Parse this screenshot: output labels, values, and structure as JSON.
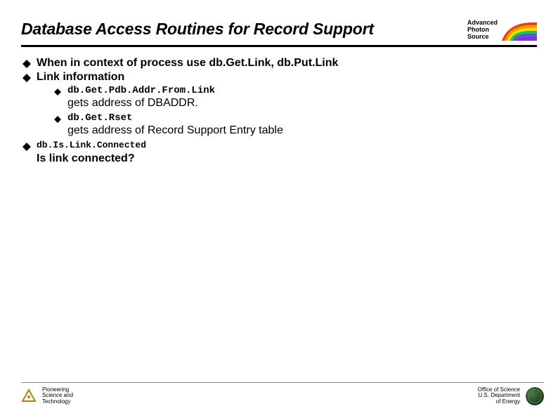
{
  "title": "Database Access Routines for Record Support",
  "logo_aps": {
    "line1": "Advanced",
    "line2": "Photon",
    "line3": "Source"
  },
  "bullets": {
    "b1": "When in context of process use db.Get.Link, db.Put.Link",
    "b2": "Link information",
    "b2a_code": "db.Get.Pdb.Addr.From.Link",
    "b2a_desc": "gets address of DBADDR.",
    "b2b_code": "db.Get.Rset",
    "b2b_desc": "gets address of Record Support Entry table",
    "b3_code": "db.Is.Link.Connected",
    "b3_desc": "Is link connected?"
  },
  "footer": {
    "left1": "Pioneering",
    "left2": "Science and",
    "left3": "Technology",
    "right1": "Office of Science",
    "right2": "U.S. Department",
    "right3": "of Energy"
  }
}
